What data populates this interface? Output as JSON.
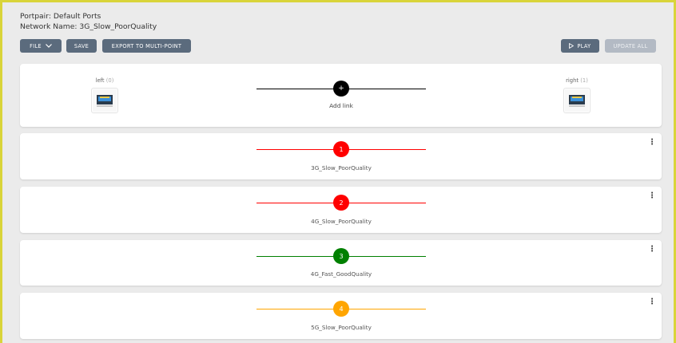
{
  "header": {
    "portpair_label": "Portpair: Default Ports",
    "network_label": "Network Name: 3G_Slow_PoorQuality"
  },
  "toolbar": {
    "file_label": "FILE",
    "save_label": "SAVE",
    "export_label": "EXPORT TO MULTI-POINT",
    "play_label": "PLAY",
    "update_all_label": "UPDATE ALL"
  },
  "endpoints": {
    "left": {
      "label": "left",
      "index": "(0)"
    },
    "right": {
      "label": "right",
      "index": "(1)"
    }
  },
  "add_link": {
    "symbol": "+",
    "label": "Add link",
    "color": "#000000"
  },
  "links": [
    {
      "number": "1",
      "name": "3G_Slow_PoorQuality",
      "color": "#ff0000"
    },
    {
      "number": "2",
      "name": "4G_Slow_PoorQuality",
      "color": "#ff0000"
    },
    {
      "number": "3",
      "name": "4G_Fast_GoodQuality",
      "color": "#008000"
    },
    {
      "number": "4",
      "name": "5G_Slow_PoorQuality",
      "color": "#ffa500"
    }
  ],
  "colors": {
    "frame": "#d9d43a",
    "button": "#5b6b7d",
    "button_disabled": "#b3bac4"
  },
  "icons": {
    "menu": "kebab-menu-icon",
    "play": "play-icon",
    "file": "chevron-down-icon",
    "endpoint": "ethernet-port-icon"
  }
}
